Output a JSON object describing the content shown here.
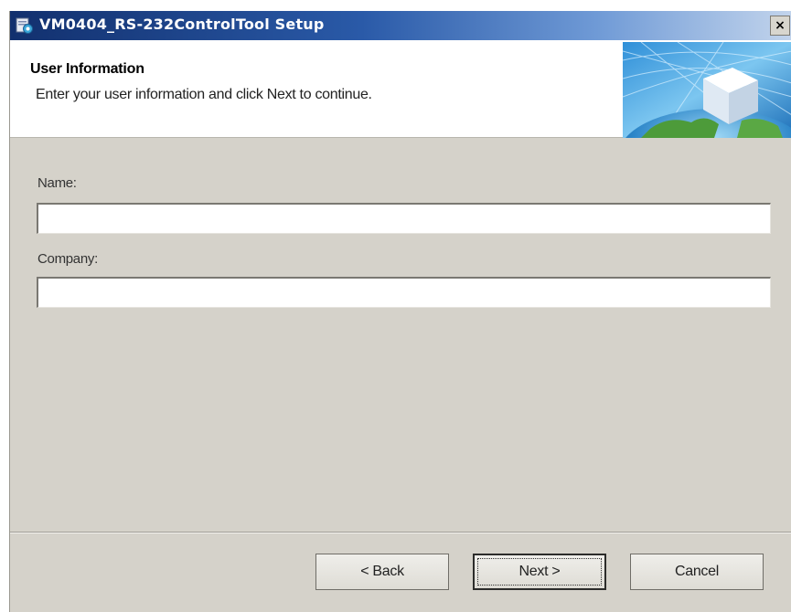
{
  "window": {
    "title": "VM0404_RS-232ControlTool Setup",
    "close_label": "×",
    "icons": [
      "setup-app-icon",
      "close-icon",
      "globe-cube-banner-image"
    ]
  },
  "banner": {
    "title": "User Information",
    "subtitle": "Enter your user information and click Next to continue."
  },
  "form": {
    "name_label": "Name:",
    "name_value": "",
    "company_label": "Company:",
    "company_value": ""
  },
  "buttons": {
    "back": "< Back",
    "next": "Next >",
    "cancel": "Cancel",
    "default_button": "next"
  },
  "colors": {
    "title_bar_start": "#12306e",
    "title_bar_end": "#c2d4ec",
    "dialog_body": "#d5d2ca",
    "banner_background": "#ffffff"
  }
}
